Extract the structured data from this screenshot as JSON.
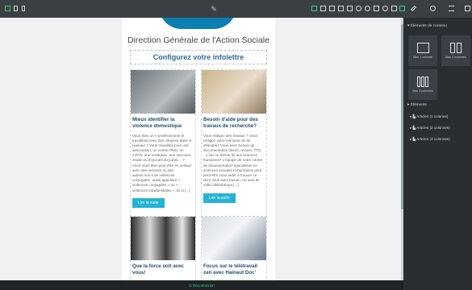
{
  "toolbar": {
    "logo_text": "✎",
    "left_icons": [
      "desktop-view-icon",
      "tablet-view-icon",
      "mobile-view-icon"
    ],
    "right_icons": [
      "select-icon",
      "fullscreen-icon",
      "code-icon",
      "download-icon",
      "import-icon",
      "undo-icon",
      "redo-icon",
      "delete-icon",
      "preview-icon",
      "settings-icon",
      "export-icon"
    ],
    "right_group_icons": [
      "brush-icon",
      "gear-icon",
      "menu-icon",
      "grid-icon"
    ],
    "accent_color": "#37d08a"
  },
  "newsletter": {
    "title": "Direction Générale de l'Action Sociale",
    "configure": "Configurez votre infolettre",
    "read_label": "Lire la suite",
    "articles": [
      {
        "title": "Mieux identifier la violence domestique",
        "body": "Vous êtes un·e professionnel·le travaillant avec des citoyens dans le Hainaut ? Vous travaillez pour une association, un centre PMS, un CPAS, une institution, une structure d'aide ou d'accueil du public... ? Alors vous êtes peut-être en contact avec des victimes ou des auteur·rice·s de violences conjugales, aussi appelées « violences conjugales » ou « violences intrafamiliales ». Et si [...]"
      },
      {
        "title": "Besoin d'aide pour des travaux de recherche?",
        "body": "Vous rédigez des travaux ? Vous rédigez votre mémoire de fin d'études? Vous avez besoin de documentation (livres, revues, TFE, ...) sur un thème lié aux sciences humaines? L'équipe de notre centre de documentation spécialisée en sciences sociales et humaines peut peut-être vous aider à trouver ce dont vous avez besoin. Au sein de cette bibliothèque [...]"
      },
      {
        "title": "Que la force soit avec vous!",
        "body": ""
      },
      {
        "title": "Focus sur le télétravail zen avec Hainaut Doc'",
        "body": ""
      }
    ]
  },
  "panel": {
    "layout_section": "Éléments de contenu",
    "blocks": [
      {
        "label": "Bloc 1 colonne",
        "icon": "one-column-icon"
      },
      {
        "label": "Bloc 2 colonnes",
        "icon": "two-columns-icon"
      },
      {
        "label": "Bloc 3 colonnes",
        "icon": "three-columns-icon"
      }
    ],
    "elements_section": "Éléments",
    "items": [
      "Articles (1 colonne)",
      "Articles (2 colonnes)",
      "Articles (3 colonnes)"
    ]
  },
  "footer": {
    "label": "Déconnexion"
  }
}
